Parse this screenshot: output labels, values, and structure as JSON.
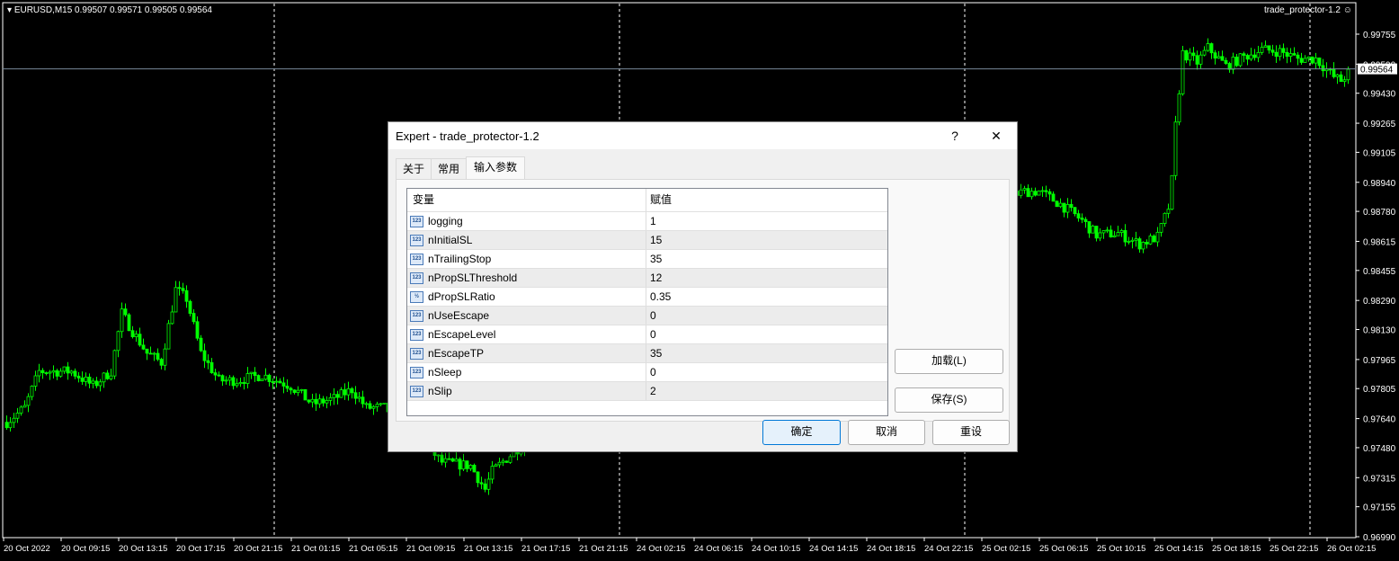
{
  "chart": {
    "symbol_info": "EURUSD,M15  0.99507 0.99571 0.99505 0.99564",
    "ea_label": "trade_protector-1.2",
    "current_price": "0.99564"
  },
  "chart_data": {
    "type": "candlestick",
    "symbol": "EURUSD",
    "timeframe": "M15",
    "y_ticks": [
      "0.99755",
      "0.99590",
      "0.99430",
      "0.99265",
      "0.99105",
      "0.98940",
      "0.98780",
      "0.98615",
      "0.98455",
      "0.98290",
      "0.98130",
      "0.97965",
      "0.97805",
      "0.97640",
      "0.97480",
      "0.97315",
      "0.97155",
      "0.96990"
    ],
    "ylim": [
      0.9699,
      0.99755
    ],
    "x_ticks": [
      "20 Oct 2022",
      "20 Oct 09:15",
      "20 Oct 13:15",
      "20 Oct 17:15",
      "20 Oct 21:15",
      "21 Oct 01:15",
      "21 Oct 05:15",
      "21 Oct 09:15",
      "21 Oct 13:15",
      "21 Oct 17:15",
      "21 Oct 21:15",
      "24 Oct 02:15",
      "24 Oct 06:15",
      "24 Oct 10:15",
      "24 Oct 14:15",
      "24 Oct 18:15",
      "24 Oct 22:15",
      "25 Oct 02:15",
      "25 Oct 06:15",
      "25 Oct 10:15",
      "25 Oct 14:15",
      "25 Oct 18:15",
      "25 Oct 22:15",
      "26 Oct 02:15"
    ],
    "day_separators_after_tick": [
      4,
      10,
      16,
      22
    ],
    "close_path": [
      [
        1,
        0.9762
      ],
      [
        6,
        0.977
      ],
      [
        10,
        0.979
      ],
      [
        19,
        0.979
      ],
      [
        25,
        0.9782
      ],
      [
        30,
        0.979
      ],
      [
        33,
        0.9822
      ],
      [
        36,
        0.9812
      ],
      [
        40,
        0.98
      ],
      [
        44,
        0.9795
      ],
      [
        48,
        0.9835
      ],
      [
        51,
        0.983
      ],
      [
        55,
        0.98
      ],
      [
        60,
        0.9785
      ],
      [
        65,
        0.9785
      ],
      [
        72,
        0.9788
      ],
      [
        80,
        0.9782
      ],
      [
        86,
        0.9772
      ],
      [
        92,
        0.9775
      ],
      [
        97,
        0.978
      ],
      [
        101,
        0.977
      ],
      [
        106,
        0.977
      ],
      [
        115,
        0.9755
      ],
      [
        122,
        0.974
      ],
      [
        130,
        0.9738
      ],
      [
        134,
        0.9725
      ],
      [
        136,
        0.9735
      ],
      [
        150,
        0.976
      ],
      [
        170,
        0.979
      ],
      [
        200,
        0.981
      ],
      [
        240,
        0.985
      ],
      [
        270,
        0.988
      ],
      [
        284,
        0.9889
      ],
      [
        288,
        0.9889
      ],
      [
        294,
        0.9882
      ],
      [
        300,
        0.9873
      ],
      [
        304,
        0.9865
      ],
      [
        310,
        0.9866
      ],
      [
        316,
        0.986
      ],
      [
        321,
        0.9864
      ],
      [
        324,
        0.988
      ],
      [
        325,
        0.9895
      ],
      [
        326,
        0.9925
      ],
      [
        328,
        0.9965
      ],
      [
        332,
        0.996
      ],
      [
        335,
        0.9968
      ],
      [
        340,
        0.9958
      ],
      [
        345,
        0.9963
      ],
      [
        350,
        0.9967
      ],
      [
        355,
        0.9966
      ],
      [
        360,
        0.9962
      ],
      [
        365,
        0.9962
      ],
      [
        370,
        0.9952
      ],
      [
        372,
        0.995
      ],
      [
        375,
        0.9956
      ]
    ],
    "color": "#00ff00"
  },
  "dialog": {
    "title": "Expert - trade_protector-1.2",
    "help": "?",
    "close": "✕",
    "tabs": [
      "关于",
      "常用",
      "输入参数"
    ],
    "columns": [
      "变量",
      "赋值"
    ],
    "params": [
      {
        "icon": "123",
        "name": "logging",
        "value": "1"
      },
      {
        "icon": "123",
        "name": "nInitialSL",
        "value": "15"
      },
      {
        "icon": "123",
        "name": "nTrailingStop",
        "value": "35"
      },
      {
        "icon": "123",
        "name": "nPropSLThreshold",
        "value": "12"
      },
      {
        "icon": "½",
        "name": "dPropSLRatio",
        "value": "0.35"
      },
      {
        "icon": "123",
        "name": "nUseEscape",
        "value": "0"
      },
      {
        "icon": "123",
        "name": "nEscapeLevel",
        "value": "0"
      },
      {
        "icon": "123",
        "name": "nEscapeTP",
        "value": "35"
      },
      {
        "icon": "123",
        "name": "nSleep",
        "value": "0"
      },
      {
        "icon": "123",
        "name": "nSlip",
        "value": "2"
      }
    ],
    "load": "加载(L)",
    "save": "保存(S)",
    "ok": "确定",
    "cancel": "取消",
    "reset": "重设"
  }
}
